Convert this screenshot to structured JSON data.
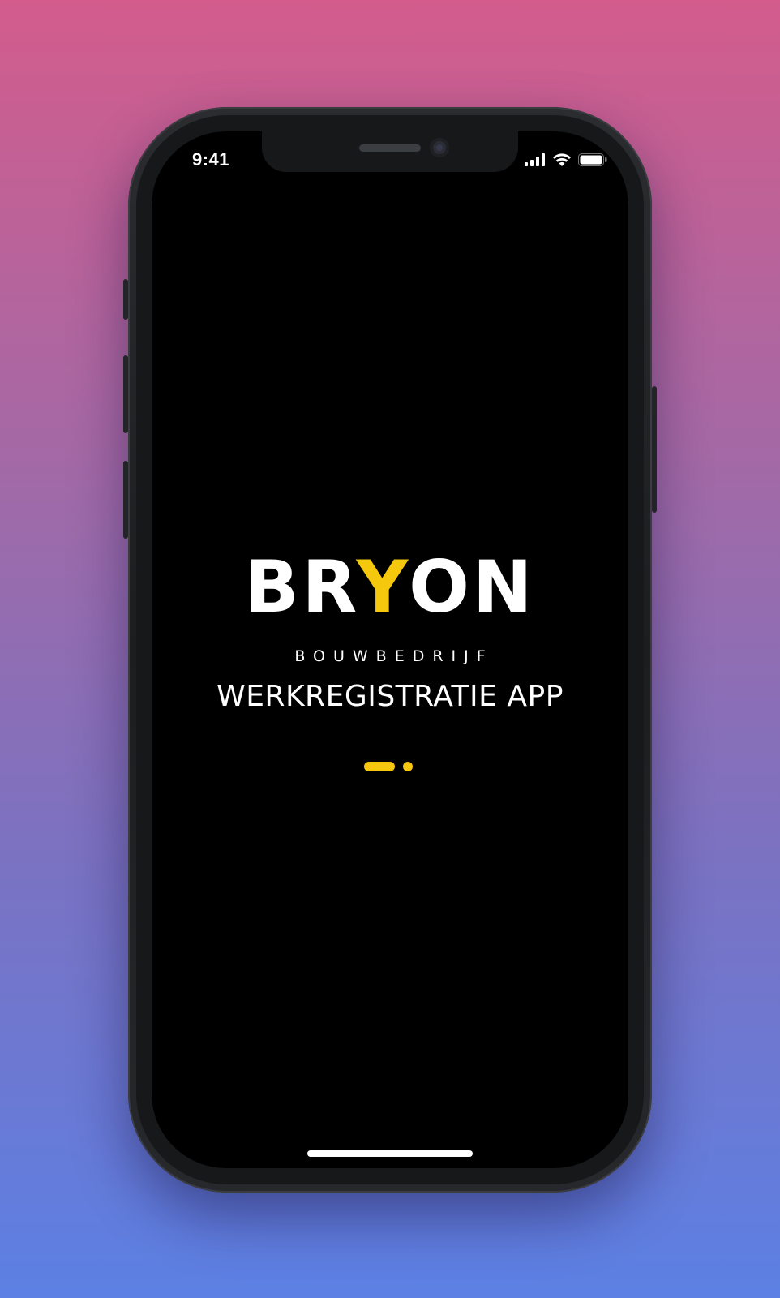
{
  "status_bar": {
    "time": "9:41",
    "icons": [
      "cellular-signal-icon",
      "wifi-icon",
      "battery-icon"
    ]
  },
  "brand": {
    "logo_prefix": "BR",
    "logo_accent": "Y",
    "logo_suffix": "ON",
    "subtitle": "BOUWBEDRIJF"
  },
  "screen": {
    "title": "WERKREGISTRATIE APP"
  },
  "colors": {
    "accent": "#f5c80d",
    "screen_background": "#000000",
    "text": "#ffffff",
    "gradient_top": "#d35c8c",
    "gradient_bottom": "#5c80e4"
  }
}
